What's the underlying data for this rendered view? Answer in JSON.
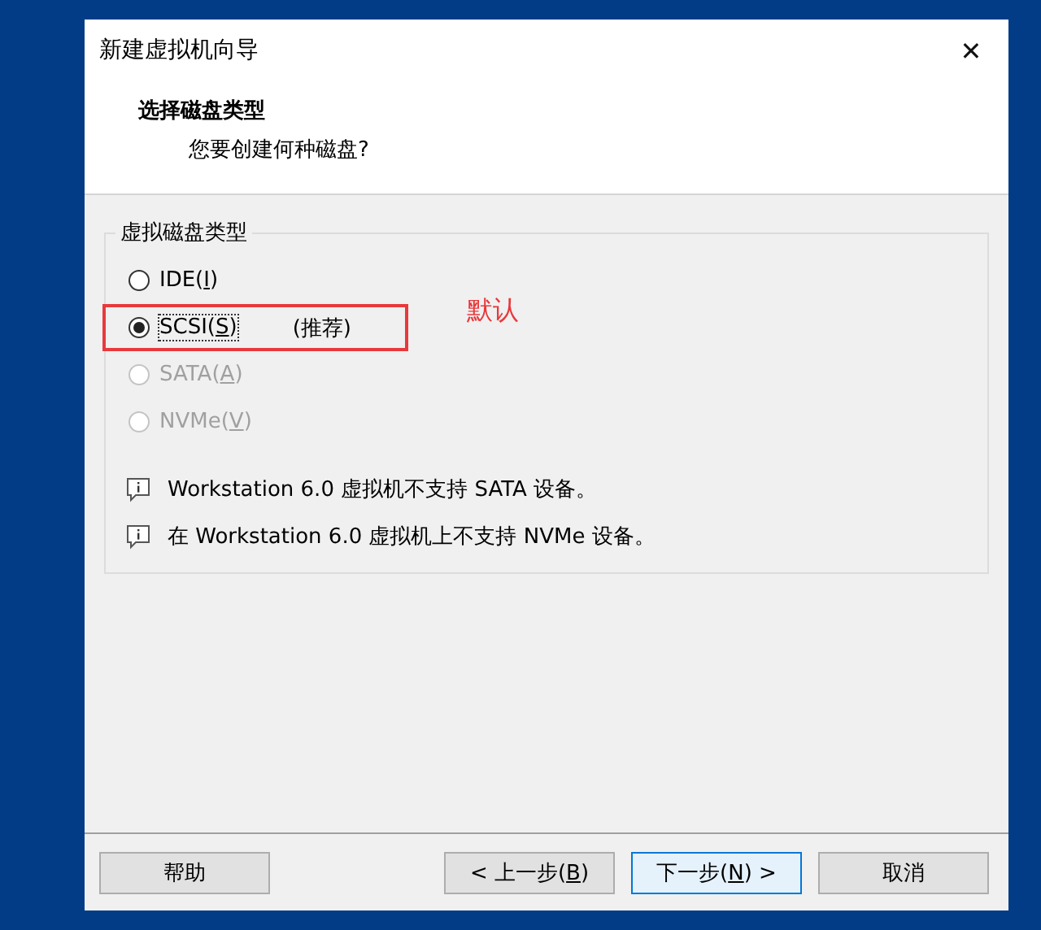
{
  "window": {
    "title": "新建虚拟机向导",
    "close": "✕"
  },
  "header": {
    "title": "选择磁盘类型",
    "subtitle": "您要创建何种磁盘?"
  },
  "group": {
    "title": "虚拟磁盘类型",
    "options": [
      {
        "before": "IDE(",
        "key": "I",
        "after": ")",
        "selected": false,
        "disabled": false,
        "annotated": false
      },
      {
        "before": "SCSI(",
        "key": "S",
        "after": ")",
        "note": "(推荐)",
        "selected": true,
        "disabled": false,
        "annotated": true
      },
      {
        "before": "SATA(",
        "key": "A",
        "after": ")",
        "selected": false,
        "disabled": true,
        "annotated": false
      },
      {
        "before": "NVMe(",
        "key": "V",
        "after": ")",
        "selected": false,
        "disabled": true,
        "annotated": false
      }
    ],
    "infos": [
      "Workstation 6.0 虚拟机不支持 SATA 设备。",
      "在 Workstation 6.0 虚拟机上不支持 NVMe 设备。"
    ]
  },
  "annotation": {
    "text": "默认"
  },
  "buttons": [
    {
      "before": "帮助",
      "default": false
    },
    {
      "before": "< 上一步(",
      "key": "B",
      "after": ")",
      "default": false
    },
    {
      "before": "下一步(",
      "key": "N",
      "after": ") >",
      "default": true
    },
    {
      "before": "取消",
      "default": false
    }
  ]
}
